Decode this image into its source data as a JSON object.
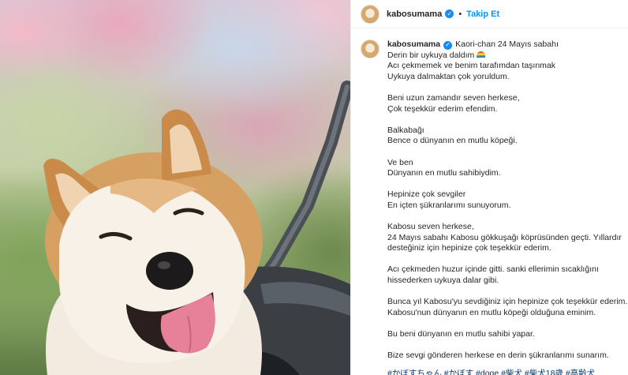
{
  "header": {
    "username": "kabosumama",
    "separator": "•",
    "follow_label": "Takip Et"
  },
  "caption": {
    "username": "kabosumama",
    "lines": [
      "Kaori-chan 24 Mayıs sabahı",
      "Derin bir uykuya daldım",
      "Acı çekmemek ve benim tarafımdan taşınmak",
      "Uykuya dalmaktan çok yoruldum.",
      "",
      "Beni uzun zamandır seven herkese,",
      "Çok teşekkür ederim efendim.",
      "",
      "Balkabağı",
      "Bence o dünyanın en mutlu köpeği.",
      "",
      "Ve ben",
      "Dünyanın en mutlu sahibiydim.",
      "",
      "Hepinize çok sevgiler",
      "En içten şükranlarımı sunuyorum.",
      "",
      "Kabosu seven herkese,",
      "24 Mayıs sabahı Kabosu gökkuşağı köprüsünden geçti. Yıllardır",
      "desteğiniz için hepinize çok teşekkür ederim.",
      "",
      "Acı çekmeden huzur içinde gitti. sanki ellerimin sıcaklığını",
      "hissederken uykuya dalar gibi.",
      "",
      "Bunca yıl Kabosu'yu sevdiğiniz için hepinize çok teşekkür ederim.",
      "Kabosu'nun dünyanın en mutlu köpeği olduğuna eminim.",
      "",
      "Bu beni dünyanın en mutlu sahibi yapar.",
      "",
      "Bize sevgi gönderen herkese en derin şükranlarımı sunarım."
    ],
    "hashtags": "#かぼすちゃん #かぼす #doge #柴犬 #柴犬18歳 #高齢犬"
  },
  "icons": {
    "verified": "verified-badge-icon",
    "rainbow": "rainbow-emoji-icon",
    "avatar": "avatar-shiba-icon"
  },
  "colors": {
    "link_blue": "#0095f6",
    "verified_blue": "#1a8cf0",
    "text": "#262626",
    "hashtag": "#00376b"
  }
}
